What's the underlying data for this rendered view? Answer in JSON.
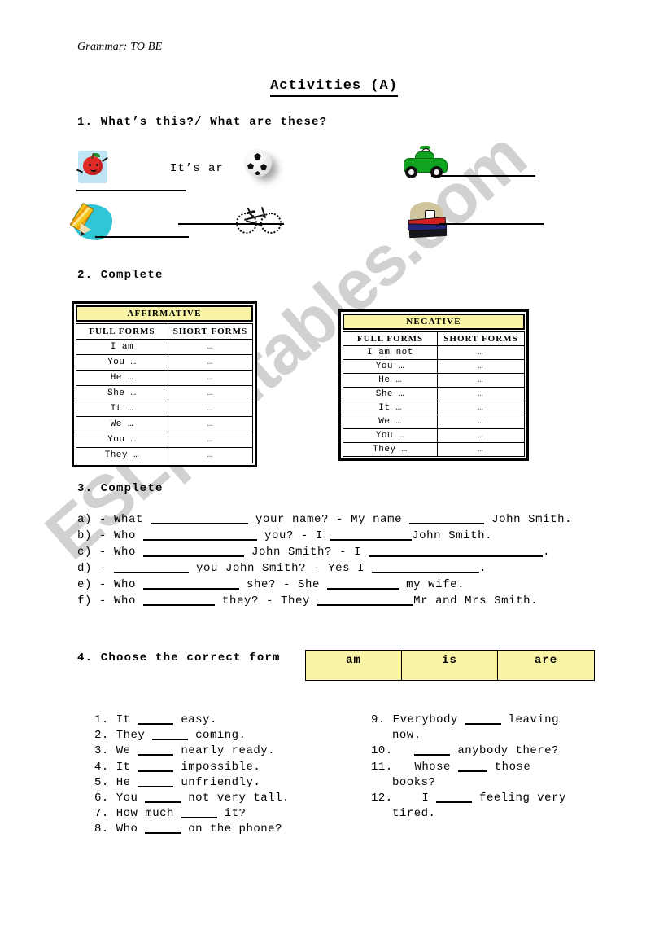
{
  "page": {
    "header_note": "Grammar: TO BE",
    "title": "Activities  (A)",
    "watermark": "ESLprintables.com",
    "accent_yellow": "#FAF4A6"
  },
  "exercise1": {
    "heading": "1. What’s this?/ What are these?",
    "prompt_text": "It’s ar",
    "pictures": [
      {
        "name": "apple-icon",
        "alt": "cartoon apple"
      },
      {
        "name": "soccer-ball-icon",
        "alt": "soccer ball"
      },
      {
        "name": "car-icon",
        "alt": "green car with driver"
      },
      {
        "name": "pencil-icon",
        "alt": "yellow pencil"
      },
      {
        "name": "bicycle-icon",
        "alt": "bicycle sketch"
      },
      {
        "name": "books-icon",
        "alt": "stack of books"
      }
    ]
  },
  "exercise2": {
    "heading": "2. Complete",
    "tables": [
      {
        "title": "AFFIRMATIVE",
        "columns": [
          "FULL FORMS",
          "SHORT FORMS"
        ],
        "rows": [
          [
            "I am",
            "…"
          ],
          [
            "You …",
            "…"
          ],
          [
            "He …",
            "…"
          ],
          [
            "She …",
            "…"
          ],
          [
            "It …",
            "…"
          ],
          [
            "We …",
            "…"
          ],
          [
            "You  …",
            "…"
          ],
          [
            "They …",
            "…"
          ]
        ]
      },
      {
        "title": "NEGATIVE",
        "columns": [
          "FULL FORMS",
          "SHORT FORMS"
        ],
        "rows": [
          [
            "I am not",
            "…"
          ],
          [
            "You …",
            "…"
          ],
          [
            "He …",
            "…"
          ],
          [
            "She …",
            "…"
          ],
          [
            "It …",
            "…"
          ],
          [
            "We …",
            "…"
          ],
          [
            "You  …",
            "…"
          ],
          [
            "They …",
            "…"
          ]
        ]
      }
    ]
  },
  "exercise3": {
    "heading": "3. Complete",
    "items": [
      {
        "label": "a) - What",
        "mid": "your name? - My name",
        "tail": "John Smith."
      },
      {
        "label": "b) - Who",
        "mid": "you? - I",
        "tail": "John Smith."
      },
      {
        "label": "c) - Who",
        "mid": "John Smith? - I",
        "tail": "."
      },
      {
        "label": "d) -",
        "mid": "you John Smith? - Yes I",
        "tail": "."
      },
      {
        "label": "e) - Who",
        "mid": "she? - She",
        "tail": "my wife."
      },
      {
        "label": "f) - Who",
        "mid": "they? - They",
        "tail": "Mr and Mrs Smith."
      }
    ]
  },
  "exercise4": {
    "heading": "4. Choose the correct form",
    "choices": [
      "am",
      "is",
      "are"
    ],
    "left_questions": [
      {
        "num": "1.",
        "before": "It",
        "after": "easy."
      },
      {
        "num": "2.",
        "before": "They",
        "after": "coming."
      },
      {
        "num": "3.",
        "before": "We",
        "after": "nearly ready."
      },
      {
        "num": "4.",
        "before": "It",
        "after": "impossible."
      },
      {
        "num": "5.",
        "before": "He",
        "after": "unfriendly."
      },
      {
        "num": "6.",
        "before": "You",
        "after": "not very tall."
      },
      {
        "num": "7.",
        "before": "How much",
        "after": "it?"
      },
      {
        "num": "8.",
        "before": "Who",
        "after": "on the phone?"
      }
    ],
    "right_questions": [
      {
        "num": "9.",
        "before": "Everybody",
        "after": "leaving",
        "cont": "now."
      },
      {
        "num": "10.",
        "before": "",
        "after": "anybody there?",
        "cont": ""
      },
      {
        "num": "11.",
        "before": "Whose",
        "after": "those",
        "cont": "books?"
      },
      {
        "num": "12.",
        "before": "I",
        "after": "feeling very",
        "cont": "tired."
      }
    ]
  }
}
